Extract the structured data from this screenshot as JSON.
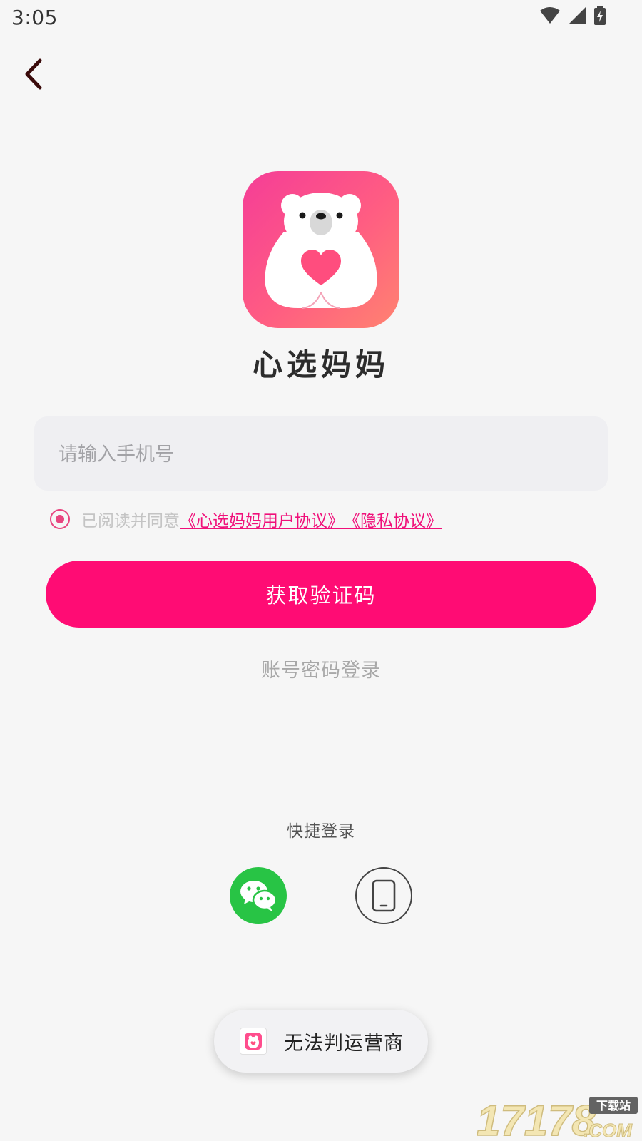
{
  "status_bar": {
    "time": "3:05",
    "icons": [
      "wifi-icon",
      "cellular-signal-icon",
      "battery-charging-icon"
    ]
  },
  "nav": {
    "back_icon": "chevron-left-icon"
  },
  "brand": {
    "app_name": "心选妈妈",
    "logo_icon": "polar-bear-heart-logo",
    "colors": {
      "logo_gradient_start": "#f53d97",
      "logo_gradient_end": "#ff8370",
      "accent": "#ff0c74"
    }
  },
  "form": {
    "phone_placeholder": "请输入手机号",
    "phone_value": "",
    "agreement": {
      "checked": true,
      "prefix": "已阅读并同意",
      "user_agreement": "《心选妈妈用户协议》",
      "privacy_agreement": "《隐私协议》"
    },
    "get_code_label": "获取验证码",
    "password_login_label": "账号密码登录"
  },
  "quick_login": {
    "label": "快捷登录",
    "options": [
      {
        "name": "wechat",
        "icon": "wechat-icon"
      },
      {
        "name": "phone",
        "icon": "mobile-phone-icon"
      }
    ]
  },
  "toast": {
    "text": "无法判运营商",
    "icon": "app-icon-small"
  },
  "watermark": {
    "text_main": "17178",
    "text_sub_top": "下载站",
    "text_sub_bottom": ".COM"
  }
}
